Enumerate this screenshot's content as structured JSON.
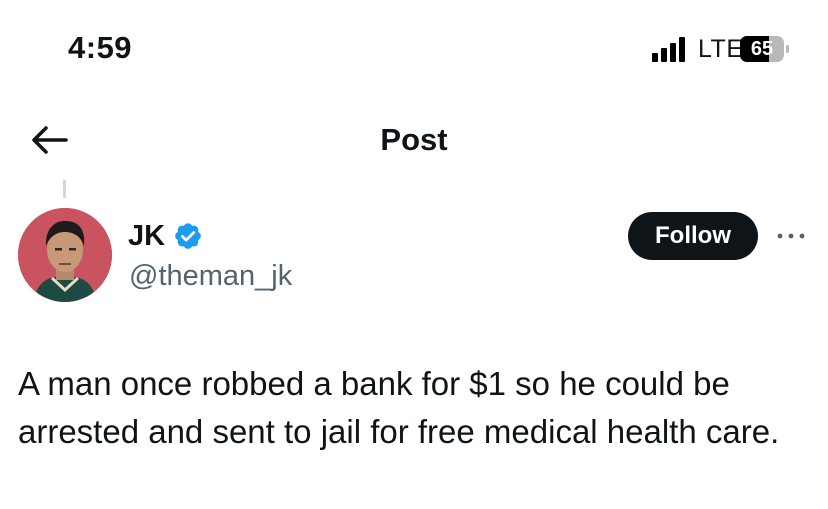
{
  "status_bar": {
    "time": "4:59",
    "network": "LTE",
    "battery_percent": "65",
    "battery_level": 0.65,
    "signal_bars": 4
  },
  "nav": {
    "title": "Post",
    "back_icon": "arrow-left-icon"
  },
  "post": {
    "author": {
      "display_name": "JK",
      "handle": "@theman_jk",
      "verified": true,
      "avatar_color": "#c9545f"
    },
    "follow_label": "Follow",
    "more_icon": "more-horizontal-icon",
    "text": "A man once robbed a bank for $1 so he could be arrested and sent to jail for free medical health care."
  },
  "colors": {
    "text_primary": "#0f1419",
    "text_secondary": "#536471",
    "verified_blue": "#1d9bf0",
    "button_dark": "#0f1419"
  }
}
